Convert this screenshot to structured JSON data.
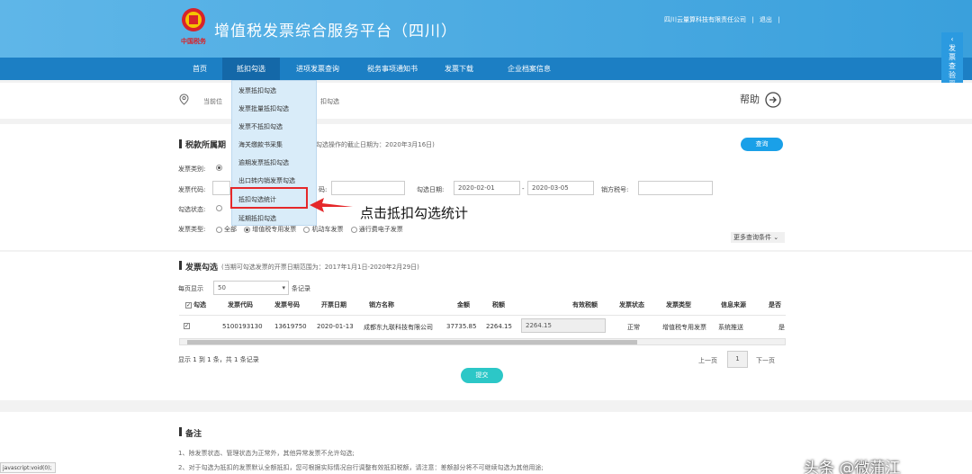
{
  "header": {
    "logo_text": "中国税务",
    "title": "增值税发票综合服务平台（四川）",
    "company": "四川云量算科技有限责任公司",
    "sep1": "|",
    "logout": "退出",
    "sep2": "|"
  },
  "nav": [
    "首页",
    "抵扣勾选",
    "进项发票查询",
    "税务事项通知书",
    "发票下载",
    "企业档案信息"
  ],
  "float_tab": "发票查验平台",
  "breadcrumb": {
    "prefix": "当前位",
    "tail": "扣勾选"
  },
  "help": "帮助",
  "dropdown": [
    "发票抵扣勾选",
    "发票批量抵扣勾选",
    "发票不抵扣勾选",
    "海关缴款书采集",
    "逾期发票抵扣勾选",
    "出口转内销发票勾选",
    "抵扣勾选统计",
    "延期抵扣勾选"
  ],
  "annotation": "点击抵扣勾选统计",
  "tax_section": {
    "title": "税款所属期",
    "note": "行勾选操作的截止日期为：2020年3月16日)",
    "query_button": "查询",
    "invoice_category_label": "发票类别:",
    "invoice_code_label": "发票代码:",
    "invoice_no_label": "码:",
    "select_date_label": "勾选日期:",
    "date_from": "2020-02-01",
    "date_sep": "-",
    "date_to": "2020-03-05",
    "seller_tax_label": "销方税号:",
    "select_status_label": "勾选状态:",
    "invoice_type_label": "发票类型:",
    "types": [
      "全部",
      "增值税专用发票",
      "机动车发票",
      "通行费电子发票"
    ],
    "more_conditions": "更多查询条件"
  },
  "table_section": {
    "title": "发票勾选",
    "note": "(当期可勾选发票的开票日期范围为：2017年1月1日-2020年2月29日)",
    "page_size_label": "每页显示",
    "page_size": "50",
    "page_size_suffix": "条记录",
    "columns": [
      "勾选",
      "发票代码",
      "发票号码",
      "开票日期",
      "销方名称",
      "金额",
      "税额",
      "有效税额",
      "发票状态",
      "发票类型",
      "信息来源",
      "是否"
    ],
    "row": {
      "code": "5100193130",
      "number": "13619750",
      "date": "2020-01-13",
      "seller": "成都东九联科技有限公司",
      "amount": "37735.85",
      "tax": "2264.15",
      "valid_tax": "2264.15",
      "status": "正常",
      "type": "增值税专用发票",
      "source": "系统推送",
      "extra": "是"
    },
    "summary": "显示 1 到 1 条，共 1 条记录",
    "prev": "上一页",
    "page": "1",
    "next": "下一页",
    "submit": "提交"
  },
  "remarks": {
    "title": "备注",
    "line1": "1、除发票状态、管理状态为正常外，其他异常发票不允许勾选;",
    "line2": "2、对于勾选为抵扣的发票默认全额抵扣，您可根据实际情况自行调整有效抵扣税额，请注意：差额部分将不可继续勾选为其他用途;"
  },
  "status_bar": "javascript:void(0);",
  "watermark": "头条 @微蒲江",
  "colors": {
    "header": "#3aa0dc",
    "nav": "#1c7fc4",
    "accent": "#1aa0e8",
    "highlight": "#e5282a"
  }
}
